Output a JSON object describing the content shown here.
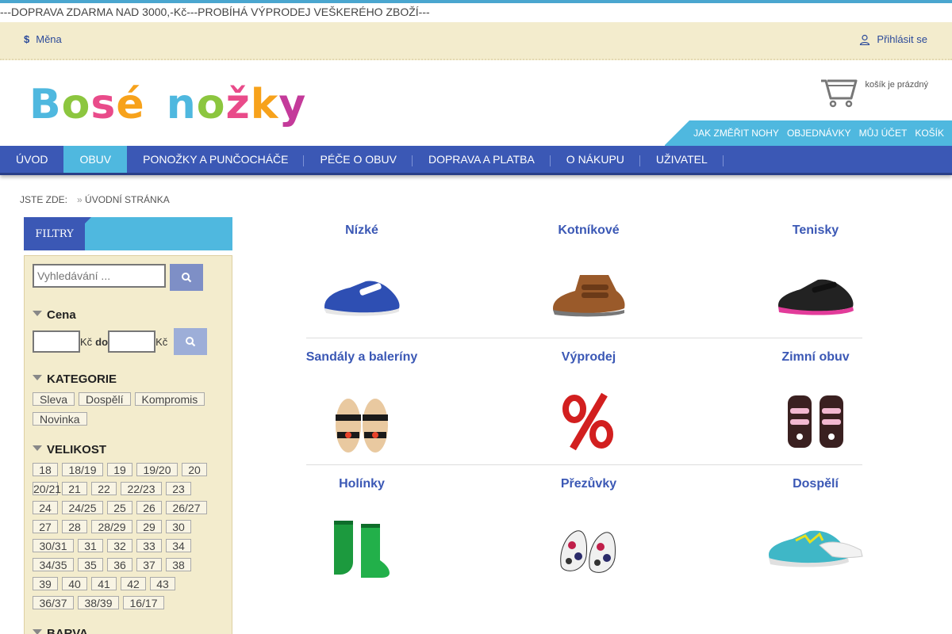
{
  "announcement": "---DOPRAVA ZDARMA NAD 3000,-Kč---PROBÍHÁ VÝPRODEJ VEŠKERÉHO ZBOŽÍ---",
  "util": {
    "currency_label": "Měna",
    "login_label": "Přihlásit se"
  },
  "logo": {
    "text": "Bosé nožky"
  },
  "cart": {
    "status": "košík je prázdný"
  },
  "subnav": [
    "JAK ZMĚŘIT NOHY",
    "OBJEDNÁVKY",
    "MŮJ ÚČET",
    "KOŠÍK"
  ],
  "mainnav": [
    "ÚVOD",
    "OBUV",
    "PONOŽKY A PUNČOCHÁČE",
    "PÉČE O OBUV",
    "DOPRAVA A PLATBA",
    "O NÁKUPU",
    "UŽIVATEL"
  ],
  "breadcrumb": {
    "prefix": "JSTE ZDE:",
    "separator": "»",
    "current": "ÚVODNÍ STRÁNKA"
  },
  "sidebar": {
    "tab": "FILTRY",
    "search_placeholder": "Vyhledávání ...",
    "price": {
      "title": "Cena",
      "currency": "Kč",
      "to": "do"
    },
    "category": {
      "title": "KATEGORIE",
      "items": [
        "Sleva",
        "Dospělí",
        "Kompromis",
        "Novinka"
      ]
    },
    "size": {
      "title": "VELIKOST",
      "rows": [
        [
          "18",
          "18/19",
          "19",
          "19/20",
          "20"
        ],
        [
          "20/21",
          "21",
          "22",
          "22/23",
          "23"
        ],
        [
          "24",
          "24/25",
          "25",
          "26",
          "26/27"
        ],
        [
          "27",
          "28",
          "28/29",
          "29",
          "30"
        ],
        [
          "30/31",
          "31",
          "32",
          "33",
          "34"
        ],
        [
          "34/35",
          "35",
          "36",
          "37",
          "38"
        ],
        [
          "39",
          "40",
          "41",
          "42",
          "43"
        ],
        [
          "36/37",
          "38/39",
          "16/17"
        ]
      ]
    },
    "color": {
      "title": "BARVA"
    }
  },
  "categories": [
    {
      "title": "Nízké",
      "icon": "low-shoe-icon"
    },
    {
      "title": "Kotníkové",
      "icon": "ankle-shoe-icon"
    },
    {
      "title": "Tenisky",
      "icon": "sneaker-icon"
    },
    {
      "title": "Sandály a baleríny",
      "icon": "sandal-icon"
    },
    {
      "title": "Výprodej",
      "icon": "percent-icon"
    },
    {
      "title": "Zimní obuv",
      "icon": "winter-boot-icon"
    },
    {
      "title": "Holínky",
      "icon": "rain-boot-icon"
    },
    {
      "title": "Přezůvky",
      "icon": "slipper-icon"
    },
    {
      "title": "Dospělí",
      "icon": "adult-shoe-icon"
    }
  ],
  "colors": {
    "brand_blue": "#3b58b5",
    "light_blue": "#4fb8df",
    "cream": "#f3eccd"
  }
}
